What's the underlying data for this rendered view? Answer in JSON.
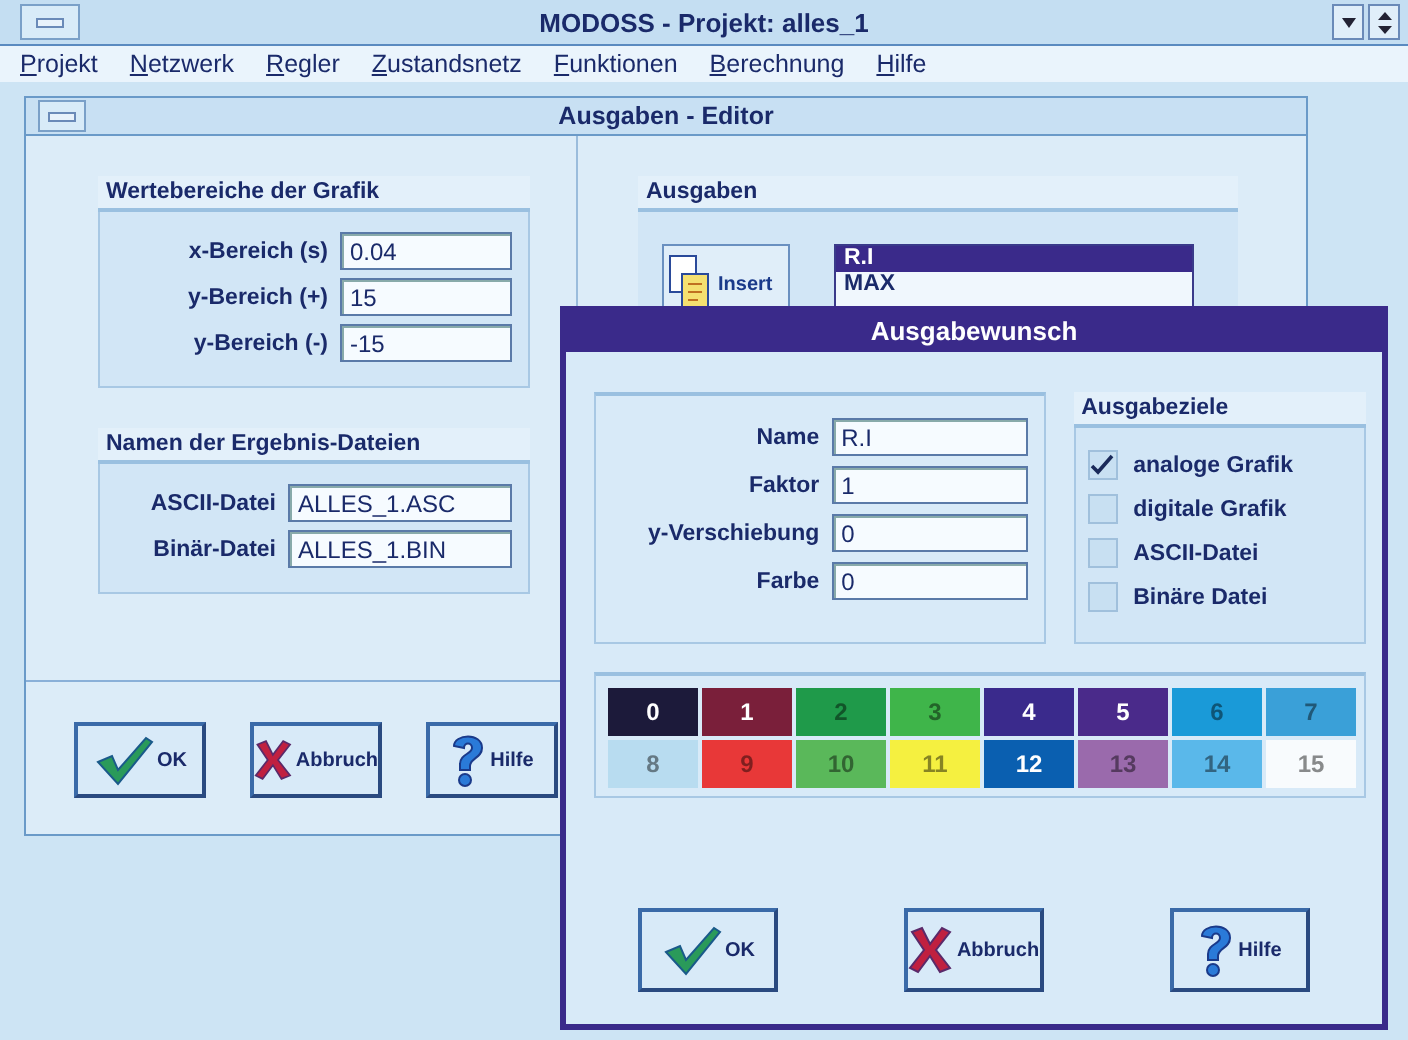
{
  "window": {
    "title": "MODOSS - Projekt: alles_1"
  },
  "menu": [
    {
      "label": "Projekt"
    },
    {
      "label": "Netzwerk"
    },
    {
      "label": "Regler"
    },
    {
      "label": "Zustandsnetz"
    },
    {
      "label": "Funktionen"
    },
    {
      "label": "Berechnung"
    },
    {
      "label": "Hilfe"
    }
  ],
  "editor": {
    "title": "Ausgaben - Editor",
    "range_group": {
      "title": "Wertebereiche der Grafik",
      "fields": [
        {
          "label": "x-Bereich (s)",
          "value": "0.04"
        },
        {
          "label": "y-Bereich (+)",
          "value": "15"
        },
        {
          "label": "y-Bereich (-)",
          "value": "-15"
        }
      ]
    },
    "files_group": {
      "title": "Namen der Ergebnis-Dateien",
      "fields": [
        {
          "label": "ASCII-Datei",
          "value": "ALLES_1.ASC"
        },
        {
          "label": "Binär-Datei",
          "value": "ALLES_1.BIN"
        }
      ]
    },
    "outputs_group": {
      "title": "Ausgaben",
      "insert_button": "Insert",
      "items": [
        {
          "label": "R.I",
          "selected": true
        },
        {
          "label": "MAX",
          "selected": false
        }
      ]
    },
    "buttons": [
      {
        "kind": "ok",
        "label": "OK"
      },
      {
        "kind": "cancel",
        "label": "Abbruch"
      },
      {
        "kind": "help",
        "label": "Hilfe"
      }
    ]
  },
  "dialog": {
    "title": "Ausgabewunsch",
    "fields": [
      {
        "label": "Name",
        "value": "R.I"
      },
      {
        "label": "Faktor",
        "value": "1"
      },
      {
        "label": "y-Verschiebung",
        "value": "0"
      },
      {
        "label": "Farbe",
        "value": "0"
      }
    ],
    "targets": {
      "title": "Ausgabeziele",
      "options": [
        {
          "label": "analoge Grafik",
          "checked": true
        },
        {
          "label": "digitale Grafik",
          "checked": false
        },
        {
          "label": "ASCII-Datei",
          "checked": false
        },
        {
          "label": "Binäre Datei",
          "checked": false
        }
      ]
    },
    "palette": [
      {
        "label": "0",
        "color": "#1c1a3a"
      },
      {
        "label": "1",
        "color": "#7a1f3a"
      },
      {
        "label": "2",
        "color": "#1f9a4a"
      },
      {
        "label": "3",
        "color": "#3fb54a"
      },
      {
        "label": "4",
        "color": "#3a2a8c"
      },
      {
        "label": "5",
        "color": "#4a2a8a"
      },
      {
        "label": "6",
        "color": "#1a9ad8"
      },
      {
        "label": "7",
        "color": "#3aa0d8"
      },
      {
        "label": "8",
        "color": "#b8dcf0"
      },
      {
        "label": "9",
        "color": "#e83838"
      },
      {
        "label": "10",
        "color": "#5ab85a"
      },
      {
        "label": "11",
        "color": "#f5f040"
      },
      {
        "label": "12",
        "color": "#0a5fb0"
      },
      {
        "label": "13",
        "color": "#9a6aac"
      },
      {
        "label": "14",
        "color": "#5ab8ea"
      },
      {
        "label": "15",
        "color": "#f8fbfd"
      }
    ],
    "buttons": [
      {
        "kind": "ok",
        "label": "OK"
      },
      {
        "kind": "cancel",
        "label": "Abbruch"
      },
      {
        "kind": "help",
        "label": "Hilfe"
      }
    ]
  }
}
